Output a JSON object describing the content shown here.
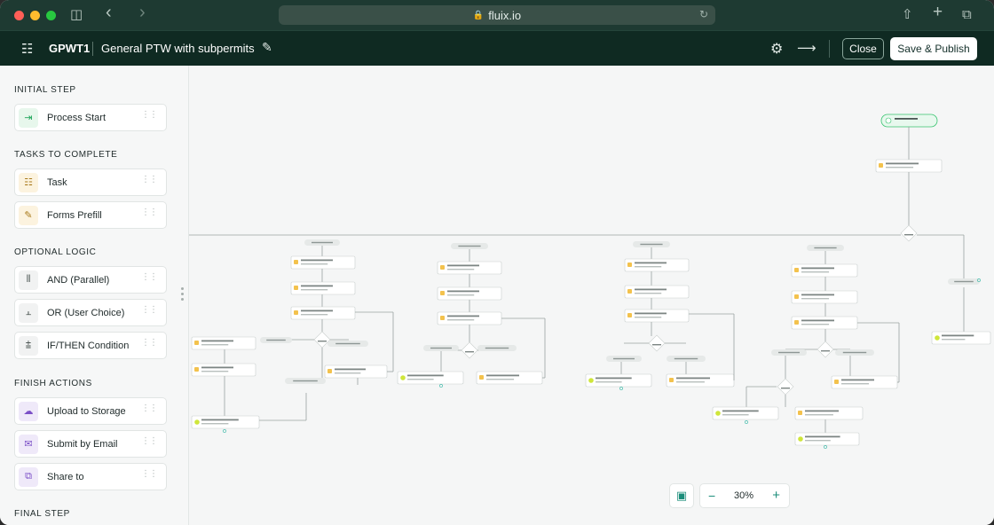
{
  "browser": {
    "url": "fluix.io",
    "traffic_colors": [
      "#ff5f57",
      "#febc2e",
      "#28c840"
    ]
  },
  "header": {
    "code": "GPWT1",
    "title": "General PTW with subpermits",
    "close_label": "Close",
    "publish_label": "Save & Publish"
  },
  "sidebar": {
    "sections": [
      {
        "title": "INITIAL STEP",
        "items": [
          {
            "label": "Process Start",
            "icon": "enter-icon",
            "glyph": "⇥",
            "tone": "green"
          }
        ]
      },
      {
        "title": "TASKS TO COMPLETE",
        "items": [
          {
            "label": "Task",
            "icon": "task-icon",
            "glyph": "☷",
            "tone": "yellow"
          },
          {
            "label": "Forms Prefill",
            "icon": "forms-prefill-icon",
            "glyph": "✎",
            "tone": "yellow"
          }
        ]
      },
      {
        "title": "OPTIONAL LOGIC",
        "items": [
          {
            "label": "AND (Parallel)",
            "icon": "parallel-icon",
            "glyph": "⫴",
            "tone": "gray"
          },
          {
            "label": "OR (User Choice)",
            "icon": "user-choice-icon",
            "glyph": "⫠",
            "tone": "gray"
          },
          {
            "label": "IF/THEN Condition",
            "icon": "condition-icon",
            "glyph": "⩲",
            "tone": "gray"
          }
        ]
      },
      {
        "title": "FINISH ACTIONS",
        "items": [
          {
            "label": "Upload to Storage",
            "icon": "cloud-upload-icon",
            "glyph": "☁",
            "tone": "purple"
          },
          {
            "label": "Submit by Email",
            "icon": "email-icon",
            "glyph": "✉",
            "tone": "purple"
          },
          {
            "label": "Share to",
            "icon": "share-to-icon",
            "glyph": "⧉",
            "tone": "purple"
          }
        ]
      },
      {
        "title": "FINAL STEP",
        "items": []
      }
    ]
  },
  "zoom": {
    "value": "30%",
    "minus": "−",
    "plus": "+"
  }
}
